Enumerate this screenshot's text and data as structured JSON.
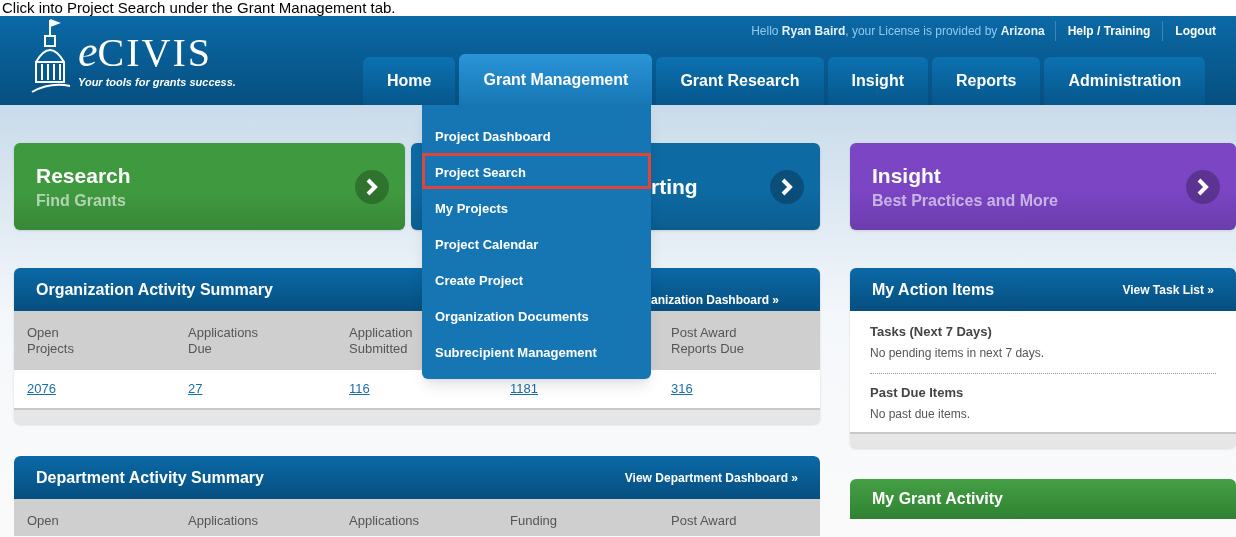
{
  "caption": "Click into Project Search under the Grant Management tab.",
  "header": {
    "logo_initial": "e",
    "logo_name": "CIVIS",
    "tagline": "Your tools for grants success.",
    "greeting": "Hello **Ryan Baird**, your License is provided by **Arizona**",
    "links": [
      "Help / Training",
      "Logout"
    ]
  },
  "tabs": [
    {
      "label": "Home",
      "selected": false
    },
    {
      "label": "Grant Management",
      "selected": true
    },
    {
      "label": "Grant Research",
      "selected": false
    },
    {
      "label": "Insight",
      "selected": false
    },
    {
      "label": "Reports",
      "selected": false
    },
    {
      "label": "Administration",
      "selected": false
    }
  ],
  "dropdown": [
    {
      "label": "Project Dashboard",
      "highlighted": false
    },
    {
      "label": "Project Search",
      "highlighted": true
    },
    {
      "label": "My Projects",
      "highlighted": false
    },
    {
      "label": "Project Calendar",
      "highlighted": false
    },
    {
      "label": "Create Project",
      "highlighted": false
    },
    {
      "label": "Organization Documents",
      "highlighted": false
    },
    {
      "label": "Subrecipient Management",
      "highlighted": false
    }
  ],
  "tiles": [
    {
      "title": "Research",
      "subtitle": "Find Grants",
      "color": "#3f9a3f"
    },
    {
      "title": "rting",
      "color": "#0d6aa3"
    },
    {
      "title": "Insight",
      "subtitle": "Best Practices and More",
      "color": "#7b45c4"
    }
  ],
  "org_summary": {
    "title": "Organization Activity Summary",
    "link": "anization Dashboard »",
    "columns": [
      "Open\nProjects",
      "Applications\nDue",
      "Application\nSubmitted",
      "",
      "Post Award\nReports Due"
    ],
    "values": [
      "2076",
      "27",
      "116",
      "1181",
      "316"
    ]
  },
  "action_items": {
    "title": "My Action Items",
    "link": "View Task List »",
    "sections": [
      {
        "heading": "Tasks (Next 7 Days)",
        "text": "No pending items in next 7 days."
      },
      {
        "heading": "Past Due Items",
        "text": "No past due items."
      }
    ]
  },
  "dept_summary": {
    "title": "Department Activity Summary",
    "link": "View Department Dashboard »",
    "columns": [
      "Open",
      "Applications",
      "Applications",
      "Funding",
      "Post Award"
    ]
  },
  "grant_activity": {
    "title": "My Grant Activity"
  }
}
